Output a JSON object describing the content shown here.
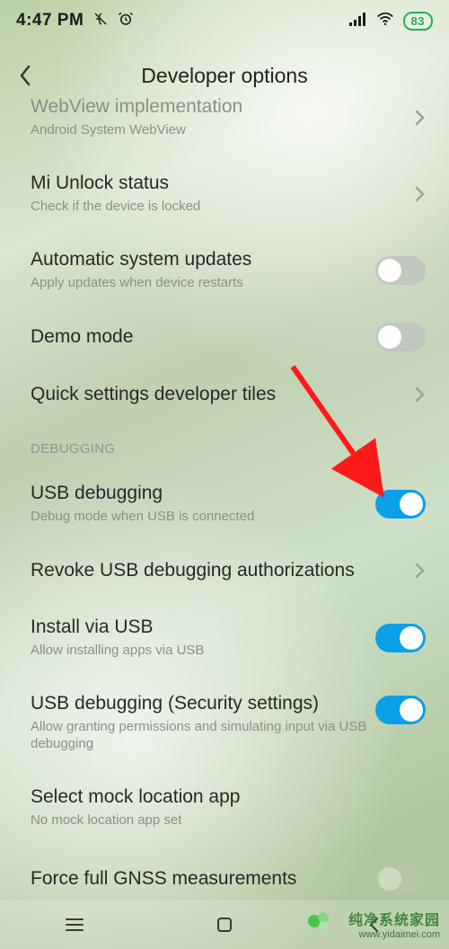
{
  "status": {
    "time": "4:47 PM",
    "battery": "83"
  },
  "header": {
    "title": "Developer  options"
  },
  "items": {
    "webview": {
      "title": "WebView implementation",
      "sub": "Android System WebView"
    },
    "miunlock": {
      "title": "Mi Unlock status",
      "sub": "Check if the device is locked"
    },
    "autoupd": {
      "title": "Automatic system updates",
      "sub": "Apply updates when device restarts"
    },
    "demo": {
      "title": "Demo mode"
    },
    "qstiles": {
      "title": "Quick settings developer tiles"
    },
    "section_debug": "DEBUGGING",
    "usbdbg": {
      "title": "USB debugging",
      "sub": "Debug mode when USB is connected"
    },
    "revoke": {
      "title": "Revoke USB debugging authorizations"
    },
    "install": {
      "title": "Install via USB",
      "sub": "Allow installing apps via USB"
    },
    "usbsec": {
      "title": "USB debugging (Security settings)",
      "sub": "Allow granting permissions and simulating input via USB debugging"
    },
    "mockloc": {
      "title": "Select mock location app",
      "sub": "No mock location app set"
    },
    "gnss": {
      "title": "Force full GNSS measurements"
    }
  },
  "watermark": {
    "line1": "纯净系统家园",
    "line2": "www.yidaimei.com"
  }
}
